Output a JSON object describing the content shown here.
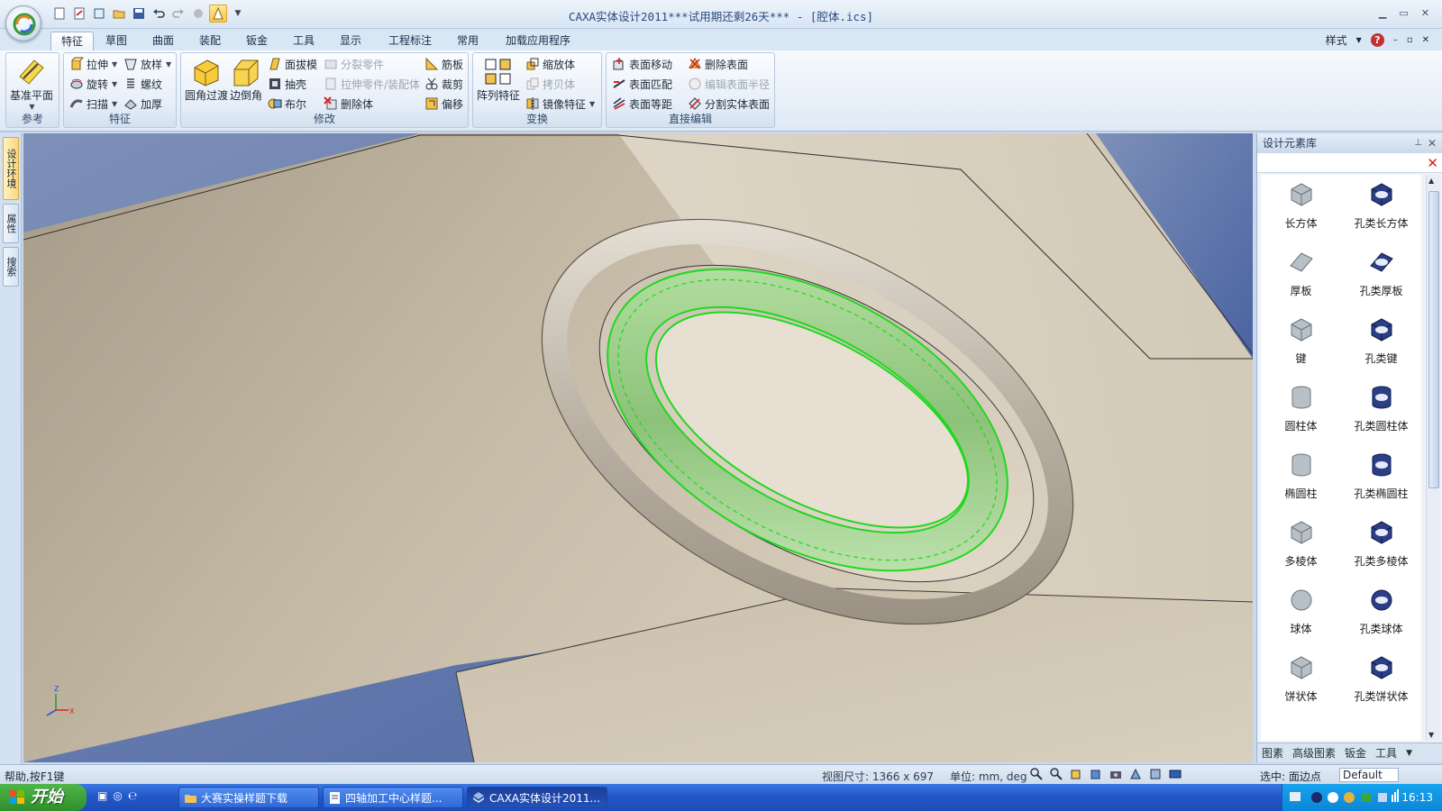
{
  "window": {
    "title": "CAXA实体设计2011***试用期还剩26天*** - [腔体.ics]"
  },
  "ribbon": {
    "tabs": [
      "特征",
      "草图",
      "曲面",
      "装配",
      "钣金",
      "工具",
      "显示",
      "工程标注",
      "常用",
      "加载应用程序"
    ],
    "active_tab": "特征",
    "style_label": "样式",
    "groups": {
      "reference": {
        "label": "参考",
        "datum_plane": "基准平面"
      },
      "feature": {
        "label": "特征",
        "extrude": "拉伸",
        "loft": "放样",
        "revolve": "旋转",
        "thread": "螺纹",
        "sweep": "扫描",
        "thicken": "加厚"
      },
      "modify": {
        "label": "修改",
        "fillet": "圆角过渡",
        "chamfer": "边倒角",
        "draft": "面拔模",
        "split_part": "分裂零件",
        "rib": "筋板",
        "shell": "抽壳",
        "extrude_part": "拉伸零件/装配体",
        "trim": "裁剪",
        "boolean": "布尔",
        "delete_body": "删除体",
        "offset": "偏移"
      },
      "transform": {
        "label": "变换",
        "pattern": "阵列特征",
        "scale": "缩放体",
        "copy": "拷贝体",
        "mirror": "镜像特征"
      },
      "direct_edit": {
        "label": "直接编辑",
        "move_face": "表面移动",
        "delete_face": "删除表面",
        "match_face": "表面匹配",
        "edit_radius": "编辑表面半径",
        "offset_face": "表面等距",
        "split_face": "分割实体表面"
      }
    }
  },
  "left_dock": {
    "tabs": [
      "设计环境",
      "属性",
      "搜索"
    ]
  },
  "panel": {
    "title": "设计元素库",
    "items": [
      {
        "label": "长方体",
        "icon": "box-icon"
      },
      {
        "label": "孔类长方体",
        "icon": "hole-box-icon"
      },
      {
        "label": "厚板",
        "icon": "plate-icon"
      },
      {
        "label": "孔类厚板",
        "icon": "hole-plate-icon"
      },
      {
        "label": "键",
        "icon": "key-icon"
      },
      {
        "label": "孔类键",
        "icon": "hole-key-icon"
      },
      {
        "label": "圆柱体",
        "icon": "cylinder-icon"
      },
      {
        "label": "孔类圆柱体",
        "icon": "hole-cylinder-icon"
      },
      {
        "label": "椭圆柱",
        "icon": "ellipse-cylinder-icon"
      },
      {
        "label": "孔类椭圆柱",
        "icon": "hole-ellipse-cylinder-icon"
      },
      {
        "label": "多棱体",
        "icon": "prism-icon"
      },
      {
        "label": "孔类多棱体",
        "icon": "hole-prism-icon"
      },
      {
        "label": "球体",
        "icon": "sphere-icon"
      },
      {
        "label": "孔类球体",
        "icon": "hole-sphere-icon"
      },
      {
        "label": "饼状体",
        "icon": "wedge-icon"
      },
      {
        "label": "孔类饼状体",
        "icon": "hole-wedge-icon"
      }
    ],
    "bottom_tabs": [
      "图素",
      "高级图素",
      "钣金",
      "工具"
    ]
  },
  "statusbar": {
    "help": "帮助,按F1键",
    "view_size": "视图尺寸: 1366 x  697",
    "units": "单位: mm, deg",
    "selection": "选中: 面边点",
    "style_value": "Default"
  },
  "taskbar": {
    "start": "开始",
    "tasks": [
      "大赛实操样题下载",
      "四轴加工中心样题...",
      "CAXA实体设计2011..."
    ],
    "clock": "16:13"
  },
  "colors": {
    "selection_green": "#1fd81f",
    "model_beige": "#c9bda8",
    "ribbon_bg": "#dfe9f5"
  }
}
